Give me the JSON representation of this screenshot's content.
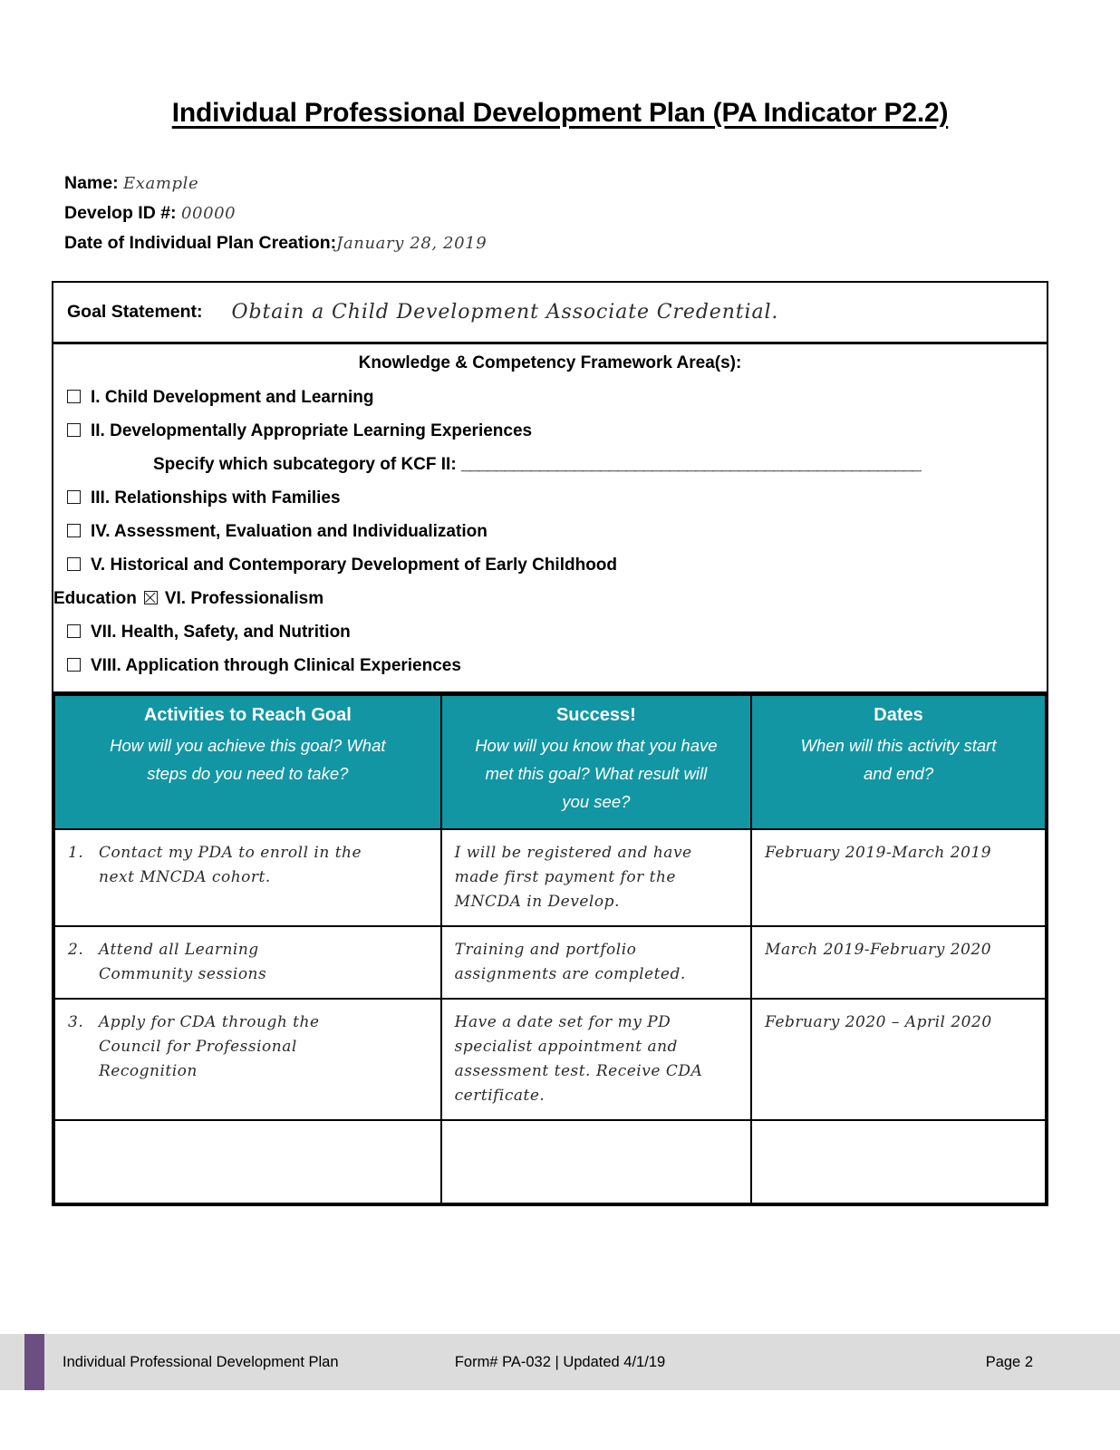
{
  "document": {
    "title": "Individual Professional Development Plan (PA Indicator P2.2)"
  },
  "identity": {
    "name_label": "Name:",
    "name_value": "Example",
    "develop_id_label": "Develop ID #:",
    "develop_id_value": "00000",
    "creation_date_label": "Date of Individual Plan Creation:",
    "creation_date_value": "January 28, 2019"
  },
  "goal": {
    "label": "Goal Statement:",
    "value": "Obtain a Child Development Associate Credential."
  },
  "kcf": {
    "heading": "Knowledge & Competency Framework Area(s):",
    "items": [
      {
        "label": "I. Child Development and Learning",
        "checked": false
      },
      {
        "label": "II. Developmentally Appropriate Learning Experiences",
        "checked": false
      },
      {
        "label": "III. Relationships with Families",
        "checked": false
      },
      {
        "label": "IV. Assessment, Evaluation and Individualization",
        "checked": false
      },
      {
        "label": "V. Historical and Contemporary Development of Early Childhood",
        "checked": false
      },
      {
        "label": "VI. Professionalism",
        "checked": true
      },
      {
        "label": "VII. Health, Safety, and Nutrition",
        "checked": false
      },
      {
        "label": "VIII. Application through Clinical Experiences",
        "checked": false
      }
    ],
    "subcategory_label": "Specify which subcategory of KCF II:",
    "subcategory_rule": "_____________________________________________________",
    "wrap_word": "Education"
  },
  "table": {
    "columns": [
      {
        "title": "Activities to Reach Goal",
        "subtitle_lines": [
          "How will you achieve this goal? What",
          "steps do you need to take?"
        ]
      },
      {
        "title": "Success!",
        "subtitle_lines": [
          "How will you know that you have",
          "met this goal? What result will",
          "you see?"
        ]
      },
      {
        "title": "Dates",
        "subtitle_lines": [
          "When will this activity start",
          "and end?"
        ]
      }
    ],
    "rows": [
      {
        "number": "1.",
        "activity_lines": [
          "Contact my PDA to enroll in the",
          "next MNCDA cohort."
        ],
        "success_lines": [
          "I will be registered and have",
          "made first payment for the",
          "MNCDA in Develop."
        ],
        "dates_lines": [
          "February 2019-March 2019"
        ]
      },
      {
        "number": "2.",
        "activity_lines": [
          "Attend all Learning",
          "Community sessions"
        ],
        "success_lines": [
          "Training and portfolio",
          "assignments are completed."
        ],
        "dates_lines": [
          "March 2019-February 2020"
        ]
      },
      {
        "number": "3.",
        "activity_lines": [
          "Apply for CDA through the",
          "Council for Professional",
          "Recognition"
        ],
        "success_lines": [
          "Have a date set for my PD",
          "specialist appointment and",
          "assessment test. Receive CDA",
          "certificate."
        ],
        "dates_lines": [
          "February 2020 – April 2020"
        ]
      },
      {
        "number": "",
        "activity_lines": [],
        "success_lines": [],
        "dates_lines": []
      }
    ]
  },
  "footer": {
    "left": "Individual Professional Development Plan",
    "center": "Form# PA-032 | Updated 4/1/19",
    "right": "Page 2"
  },
  "colors": {
    "table_header_teal": "#1296A3",
    "footer_band": "#dcdcdc",
    "footer_accent_purple": "#6B4E82",
    "ink": "#000000",
    "handwriting": "#2b2b2b"
  }
}
